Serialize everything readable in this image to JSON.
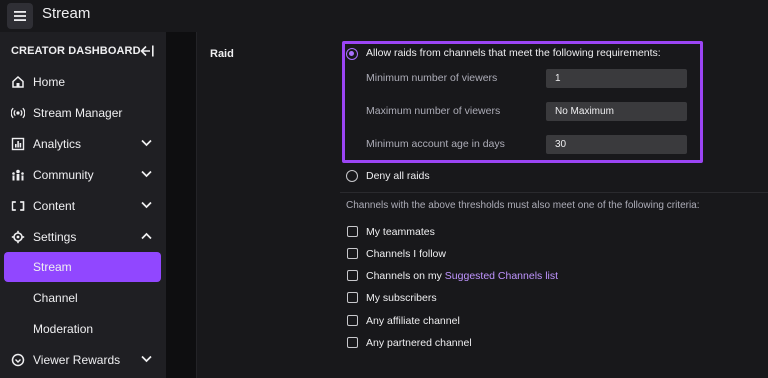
{
  "topbar": {
    "title": "Stream",
    "menu_icon": "hamburger-icon"
  },
  "sidebar": {
    "header": "CREATOR DASHBOARD",
    "items": [
      {
        "label": "Home",
        "icon": "home-icon"
      },
      {
        "label": "Stream Manager",
        "icon": "broadcast-icon"
      },
      {
        "label": "Analytics",
        "icon": "analytics-icon",
        "chevron": "down"
      },
      {
        "label": "Community",
        "icon": "community-icon",
        "chevron": "down"
      },
      {
        "label": "Content",
        "icon": "content-icon",
        "chevron": "down"
      },
      {
        "label": "Settings",
        "icon": "gear-icon",
        "chevron": "up"
      },
      {
        "label": "Stream",
        "active": true
      },
      {
        "label": "Channel"
      },
      {
        "label": "Moderation"
      },
      {
        "label": "Viewer Rewards",
        "icon": "rewards-icon",
        "chevron": "down"
      }
    ]
  },
  "raid": {
    "section_label": "Raid",
    "allow_option": "Allow raids from channels that meet the following requirements:",
    "fields": [
      {
        "label": "Minimum number of viewers",
        "value": "1"
      },
      {
        "label": "Maximum number of viewers",
        "value": "No Maximum"
      },
      {
        "label": "Minimum account age in days",
        "value": "30"
      }
    ],
    "deny_option": "Deny all raids",
    "criteria_intro": "Channels with the above thresholds must also meet one of the following criteria:",
    "criteria": [
      {
        "label": "My teammates"
      },
      {
        "label": "Channels I follow"
      },
      {
        "label": "Channels on my ",
        "link": "Suggested Channels list"
      },
      {
        "label": "My subscribers"
      },
      {
        "label": "Any affiliate channel"
      },
      {
        "label": "Any partnered channel"
      }
    ]
  },
  "colors": {
    "accent": "#9147ff",
    "highlight": "#9b45f5",
    "link": "#bf94ff"
  }
}
